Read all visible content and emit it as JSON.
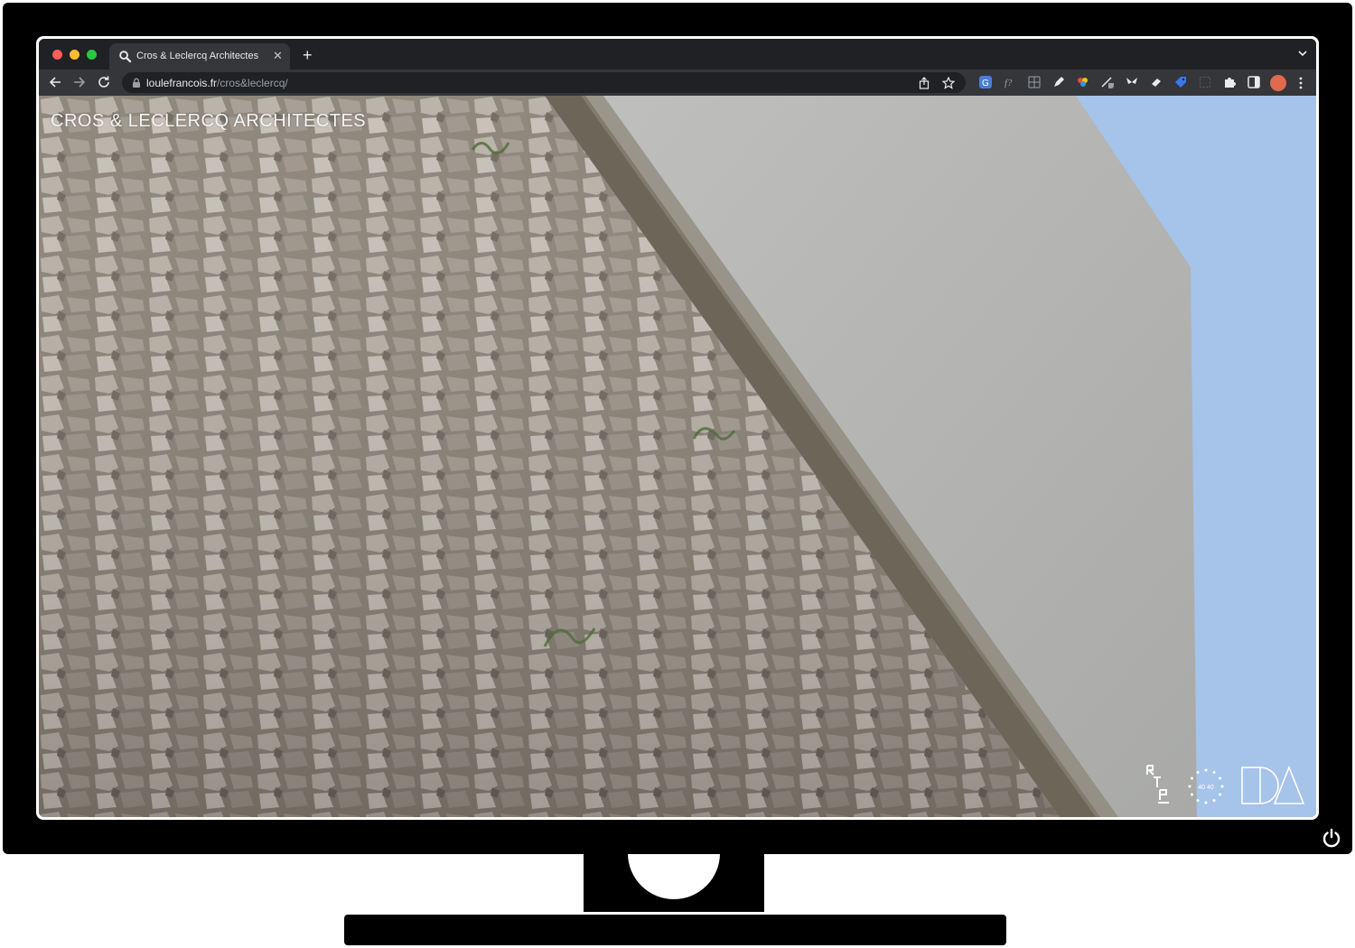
{
  "browser": {
    "tab": {
      "title": "Cros & Leclercq Architectes",
      "favicon": "magnifier-icon"
    },
    "url": {
      "host": "loulefrancois.fr",
      "path": "/cros&leclercq/"
    },
    "colors": {
      "frame": "#202124",
      "toolbar": "#35363a",
      "avatar": "#e06a4d"
    }
  },
  "page": {
    "site_title": "CROS & LECLERCQ ARCHITECTES",
    "sky_color": "#a6c3ea",
    "partner_logos": [
      "rtp-logo",
      "eu-stars-logo",
      "ida-logo"
    ]
  },
  "extensions": [
    "translate-icon",
    "fx-icon",
    "grid-icon",
    "pen-icon",
    "color-picker-icon",
    "ruler-icon",
    "moth-icon",
    "eraser-icon",
    "tag-icon",
    "selection-icon",
    "puzzle-icon",
    "sidepanel-icon"
  ]
}
